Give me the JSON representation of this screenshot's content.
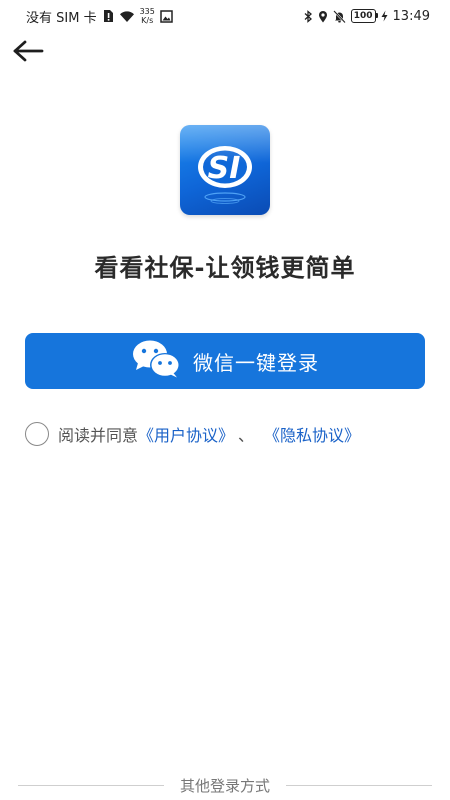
{
  "status_bar": {
    "carrier": "没有 SIM 卡",
    "net_speed_value": "335",
    "net_speed_unit": "K/s",
    "battery": "100",
    "time": "13:49",
    "icons": [
      "sim-alert-icon",
      "wifi-icon",
      "image-icon",
      "bluetooth-icon",
      "location-icon",
      "mute-icon",
      "charging-icon"
    ]
  },
  "header": {
    "back_icon": "back-arrow-icon"
  },
  "app": {
    "logo_text": "SI",
    "title": "看看社保-让领钱更简单"
  },
  "login": {
    "wechat_button_label": "微信一键登录",
    "wechat_icon": "wechat-icon"
  },
  "agreement": {
    "prefix": "阅读并同意",
    "user_agreement": "《用户协议》",
    "separator": "、",
    "privacy_policy": "《隐私协议》"
  },
  "footer": {
    "other_login_label": "其他登录方式"
  },
  "colors": {
    "primary": "#1675dc",
    "link": "#1a62c8",
    "logo_gradient_top": "#1b8af0",
    "logo_gradient_bottom": "#0a4bb4"
  }
}
